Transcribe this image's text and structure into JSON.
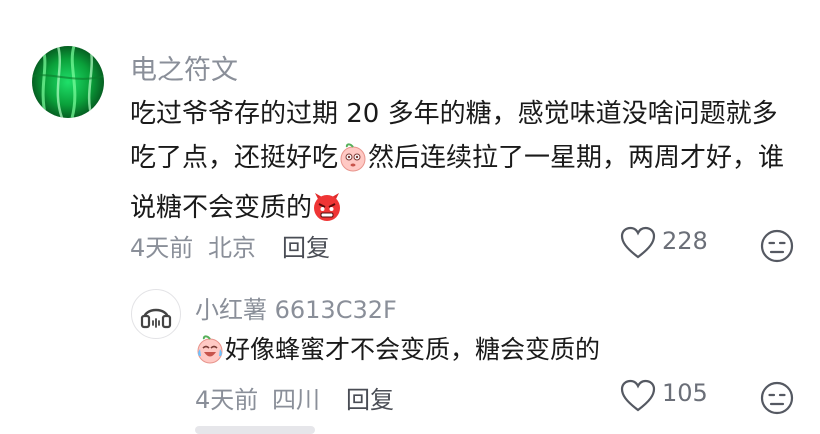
{
  "comment": {
    "username": "电之符文",
    "text_1": "吃过爷爷存的过期 20 多年的糖，感觉味道没啥问题就多吃了点，还挺好吃",
    "emoji_1": "peach-face-emoji",
    "text_2": "然后连续拉了一星期，两周才好，谁说糖不会变质的",
    "emoji_2": "angry-red-face-emoji",
    "time": "4天前",
    "location": "北京",
    "reply_label": "回复",
    "likes": "228"
  },
  "reply": {
    "username": "小红薯 6613C32F",
    "emoji": "crying-laughing-peach-emoji",
    "text": "好像蜂蜜才不会变质，糖会变质的",
    "time": "4天前",
    "location": "四川",
    "reply_label": "回复",
    "likes": "105"
  },
  "colors": {
    "meta": "#8a8f99",
    "text": "#1a1a1a",
    "avatar_green": "#1fe06a"
  }
}
